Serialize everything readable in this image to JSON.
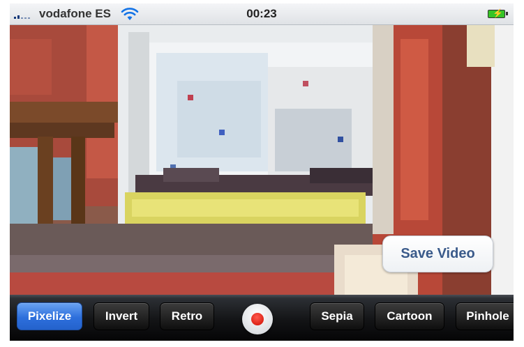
{
  "status_bar": {
    "carrier": "vodafone ES",
    "time": "00:23",
    "icons": [
      "signal-icon",
      "wifi-icon",
      "battery-charging-icon"
    ]
  },
  "camera": {
    "save_video_label": "Save Video"
  },
  "toolbar": {
    "filters": [
      "Pixelize",
      "Invert",
      "Retro",
      "Sepia",
      "Cartoon",
      "Pinhole"
    ],
    "selected": "Pixelize",
    "record_icon": "record-icon"
  },
  "colors": {
    "active_filter": "#2d6fdc",
    "record": "#e01a0f",
    "battery": "#36c426"
  }
}
